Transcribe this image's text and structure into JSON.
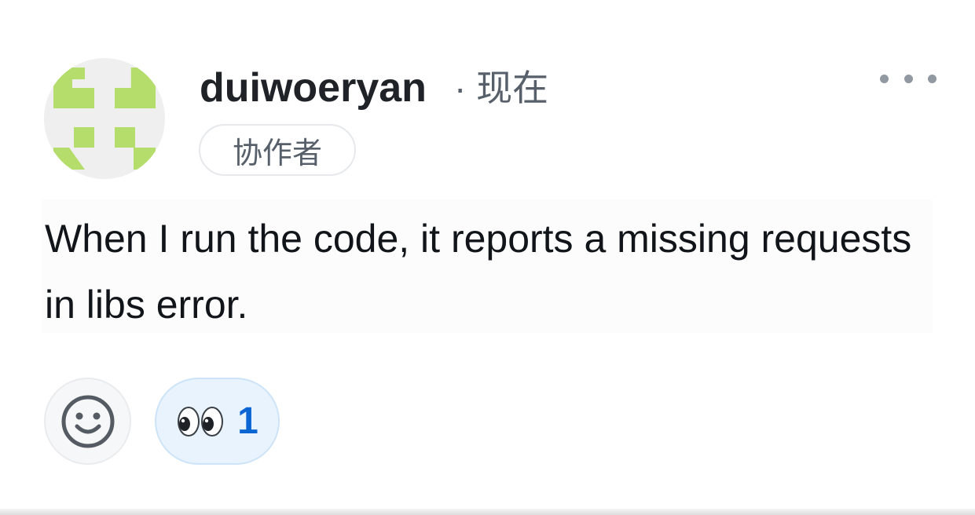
{
  "comment": {
    "author": "duiwoeryan",
    "separator": "·",
    "timestamp": "现在",
    "role_badge": "协作者",
    "body": "When I run the code, it reports a missing requests in libs error.",
    "menu_icon": "more-horizontal-icon",
    "add_reaction_icon": "smiley-icon"
  },
  "reactions": [
    {
      "emoji": "eyes",
      "count": "1"
    }
  ],
  "colors": {
    "avatar_bg": "#efefef",
    "avatar_fg": "#b5dd6b",
    "reaction_bg": "#e9f3fd",
    "reaction_count": "#0b66d4"
  }
}
